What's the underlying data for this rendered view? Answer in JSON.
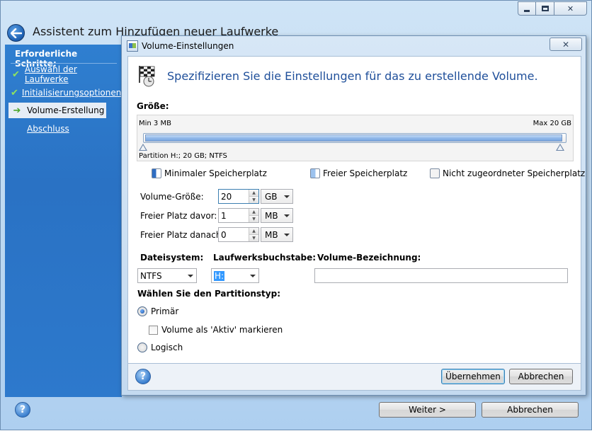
{
  "window": {
    "title": "Assistent zum Hinzufügen neuer Laufwerke"
  },
  "steps": {
    "heading": "Erforderliche Schritte:",
    "items": [
      {
        "label": "Auswahl der Laufwerke",
        "state": "done"
      },
      {
        "label": "Initialisierungsoptionen",
        "state": "done"
      },
      {
        "label": "Volume-Erstellung",
        "state": "current"
      },
      {
        "label": "Abschluss",
        "state": "pending"
      }
    ]
  },
  "footer": {
    "next_label": "Weiter >",
    "cancel_label": "Abbrechen"
  },
  "dialog": {
    "title": "Volume-Einstellungen",
    "heading": "Spezifizieren Sie die Einstellungen für das zu erstellende Volume.",
    "size": {
      "label": "Größe:",
      "min": "Min 3 MB",
      "max": "Max 20 GB",
      "partition_caption": "Partition H:; 20 GB; NTFS",
      "fill_fraction": 0.995
    },
    "legend": [
      {
        "label": "Minimaler Speicherplatz",
        "color": "#2f6dc2"
      },
      {
        "label": "Freier Speicherplatz",
        "color": "#9cc2ee"
      },
      {
        "label": "Nicht zugeordneter Speicherplatz",
        "color": "#f3f3f3"
      }
    ],
    "fields": {
      "volume_size_label": "Volume-Größe:",
      "volume_size_value": "20",
      "volume_size_unit": "GB",
      "free_before_label": "Freier Platz davor:",
      "free_before_value": "1",
      "free_before_unit": "MB",
      "free_after_label": "Freier Platz danach:",
      "free_after_value": "0",
      "free_after_unit": "MB"
    },
    "filesystem": {
      "label": "Dateisystem:",
      "value": "NTFS"
    },
    "drive_letter": {
      "label": "Laufwerksbuchstabe:",
      "value": "H:"
    },
    "volume_label": {
      "label": "Volume-Bezeichnung:",
      "value": ""
    },
    "partition_type": {
      "label": "Wählen Sie den Partitionstyp:",
      "primary_label": "Primär",
      "active_label": "Volume als 'Aktiv' markieren",
      "logical_label": "Logisch",
      "selected": "primary"
    },
    "apply_label": "Übernehmen",
    "cancel_label": "Abbrechen"
  }
}
